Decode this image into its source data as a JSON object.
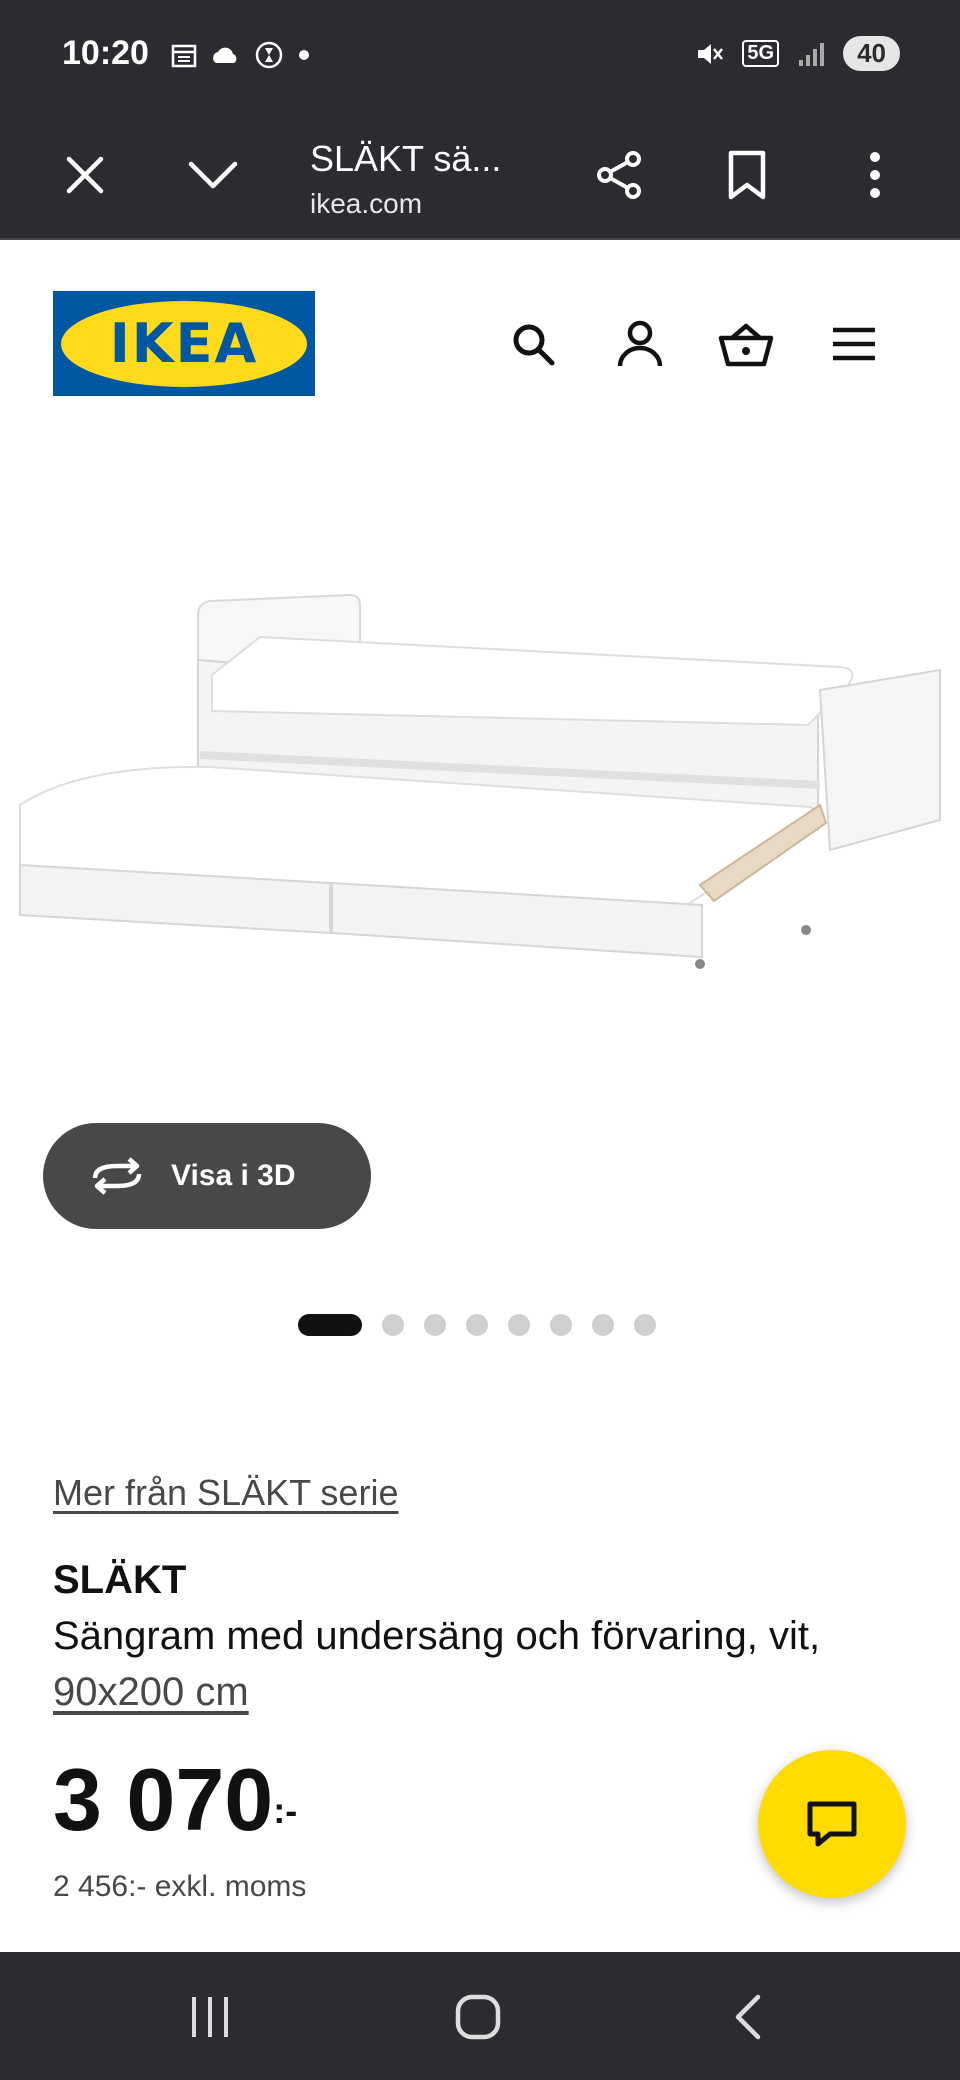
{
  "status_bar": {
    "time": "10:20",
    "battery": "40",
    "network": "5G",
    "icons": [
      "calendar-icon",
      "cloud-icon",
      "timer-icon",
      "dot-icon",
      "mute-icon",
      "network-5g-icon",
      "signal-icon",
      "battery-icon"
    ]
  },
  "browser": {
    "title": "SLÄKT sä...",
    "url": "ikea.com",
    "icons": [
      "close-icon",
      "chevron-down-icon",
      "share-icon",
      "bookmark-icon",
      "more-icon"
    ]
  },
  "site_header": {
    "logo_text": "IKEA",
    "icons": [
      "search-icon",
      "account-icon",
      "basket-icon",
      "menu-icon"
    ]
  },
  "product": {
    "view_3d_label": "Visa i 3D",
    "carousel": {
      "total": 8,
      "active_index": 0
    },
    "series_link": "Mer från SLÄKT serie",
    "name": "SLÄKT",
    "description": "Sängram med undersäng och förvaring, vit, ",
    "size": "90x200 cm",
    "price_main": "3 070",
    "price_suffix": ":-",
    "price_ex_vat": "2 456:- exkl. moms"
  },
  "chat": {
    "icon": "chat-icon"
  },
  "nav_bar": {
    "icons": [
      "recent-apps-icon",
      "home-icon",
      "back-icon"
    ]
  },
  "colors": {
    "ikea_blue": "#0058a3",
    "ikea_yellow": "#ffda1a",
    "chat_yellow": "#ffdb00",
    "dark_bar": "#2b2c30"
  }
}
